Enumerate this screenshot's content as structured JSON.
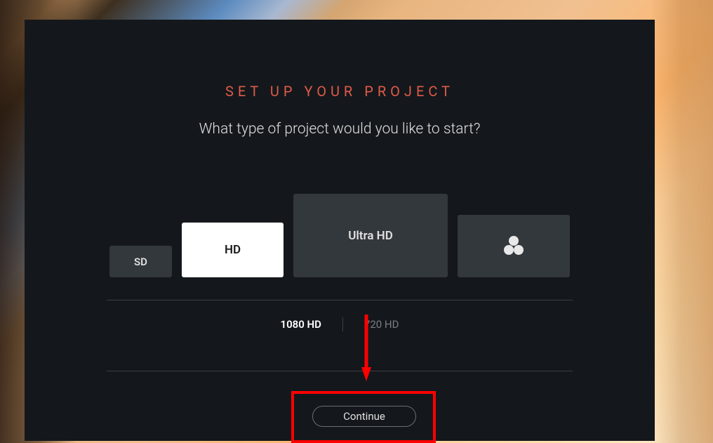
{
  "title": "SET UP YOUR PROJECT",
  "subtitle": "What type of project would you like to start?",
  "cards": {
    "sd": "SD",
    "hd": "HD",
    "uhd": "Ultra HD"
  },
  "sub_options": {
    "opt1": "1080 HD",
    "opt2": "720 HD"
  },
  "continue_label": "Continue"
}
